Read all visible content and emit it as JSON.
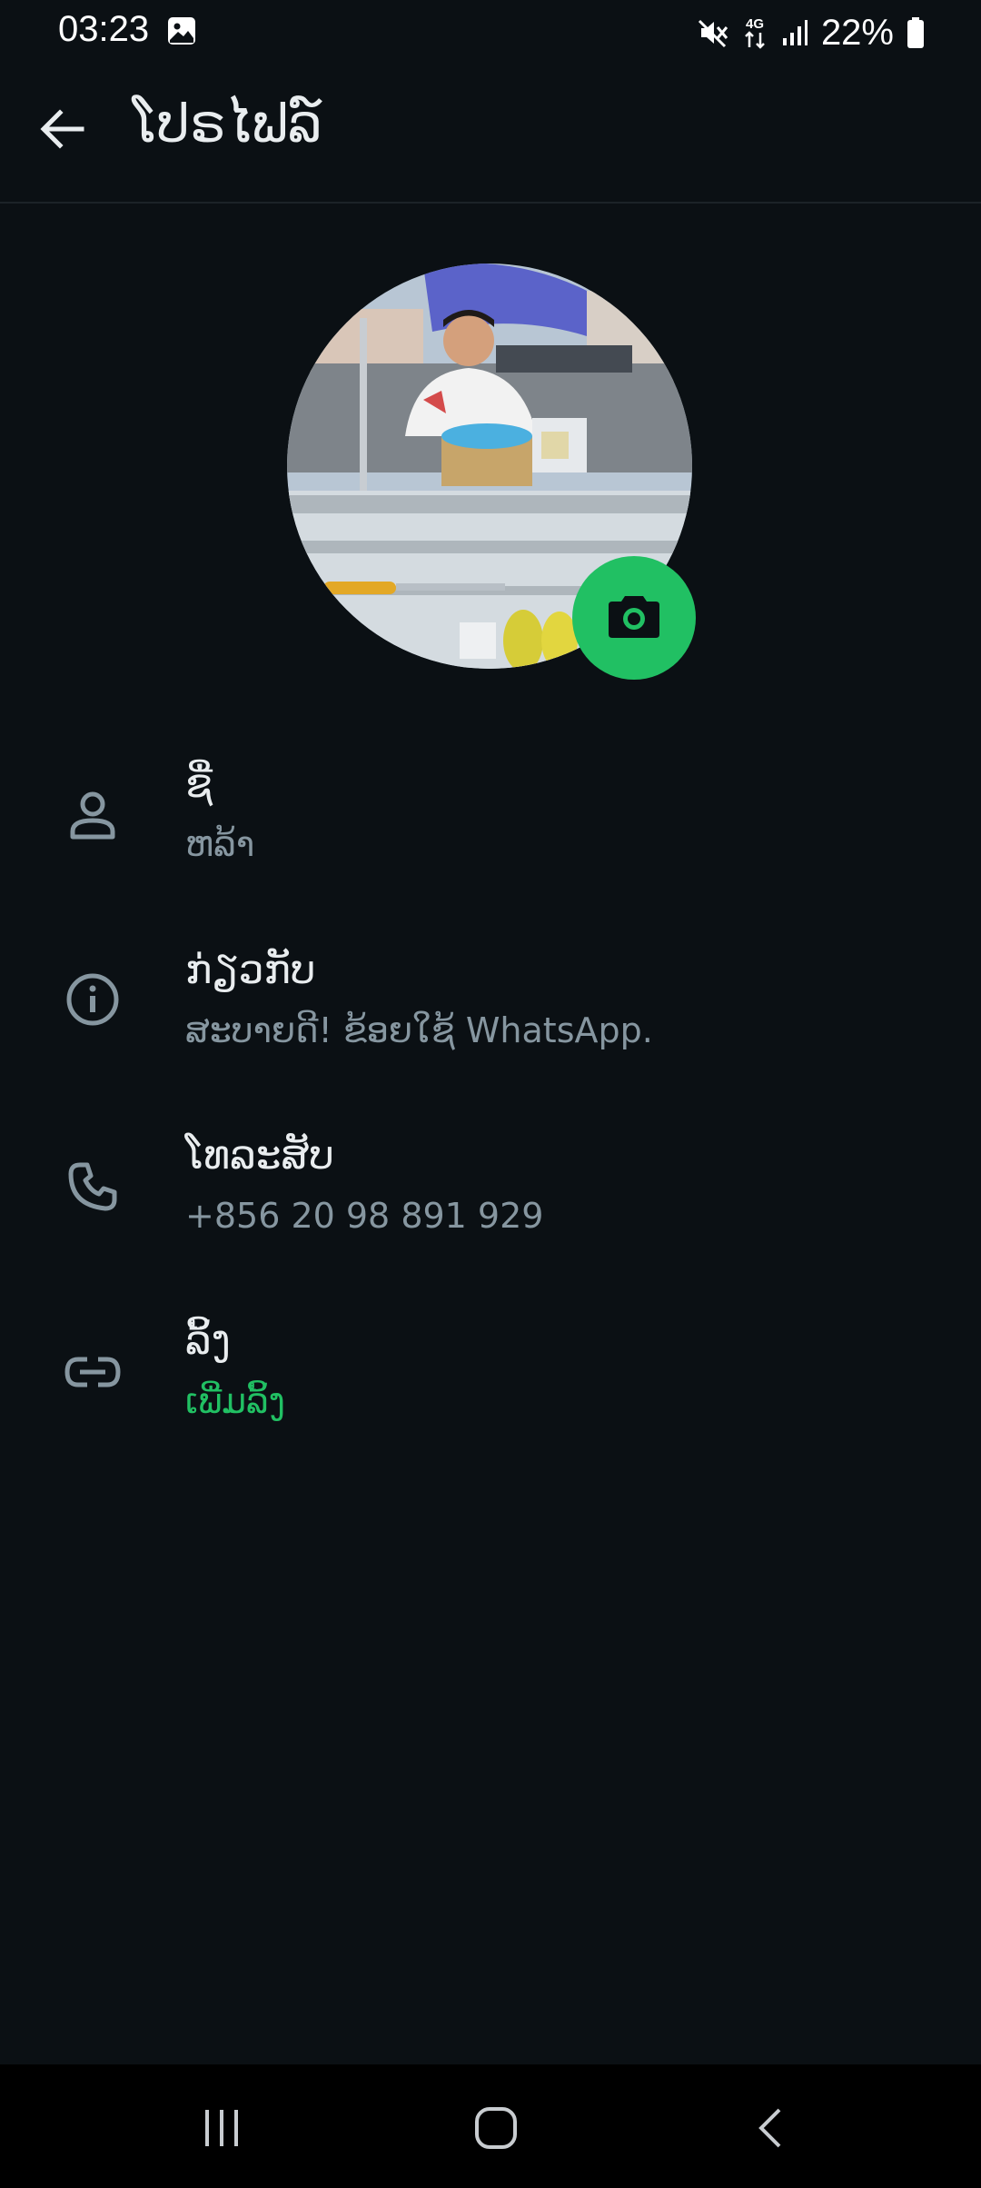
{
  "status_bar": {
    "time": "03:23",
    "network": "4G",
    "battery": "22%",
    "icons": [
      "gallery-icon",
      "mute-icon",
      "network-4g-icon",
      "signal-icon",
      "battery-icon"
    ]
  },
  "app_bar": {
    "title": "ໂປຣໄຟລ໌",
    "back_icon": "arrow-back-icon"
  },
  "profile": {
    "avatar_alt": "profile-photo",
    "camera_icon": "camera-icon",
    "accent_color": "#21c063"
  },
  "rows": {
    "name": {
      "label": "ຊື່",
      "value": "ຫລ້າ",
      "icon": "person-icon"
    },
    "about": {
      "label": "ກ່ຽວກັບ",
      "value": "ສະບາຍດີ! ຂ້ອຍໃຊ້ WhatsApp.",
      "icon": "info-icon"
    },
    "phone": {
      "label": "ໂທລະສັບ",
      "value": "+856 20 98 891 929",
      "icon": "phone-icon"
    },
    "links": {
      "label": "ລິ້ງ",
      "value": "ເພີ່ມລິ້ງ",
      "icon": "link-icon"
    }
  },
  "nav_bar": {
    "icons": [
      "recent-apps-icon",
      "home-icon",
      "back-nav-icon"
    ]
  }
}
